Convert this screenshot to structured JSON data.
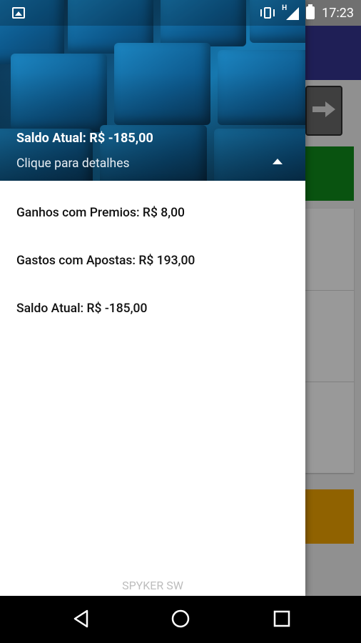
{
  "status_bar": {
    "time": "17:23",
    "icons": [
      "image-icon",
      "vibrate-icon",
      "signal-h-icon",
      "battery-icon"
    ],
    "signal_label": "H"
  },
  "drawer": {
    "header": {
      "title": "Saldo Atual: R$ -185,00",
      "subtitle": "Clique para detalhes",
      "toggle_icon": "caret-up-icon"
    },
    "items": [
      {
        "label": "Ganhos com Premios: R$ 8,00"
      },
      {
        "label": "Gastos com Apostas: R$ 193,00"
      },
      {
        "label": "Saldo Atual: R$ -185,00"
      }
    ],
    "footer": "SPYKER SW"
  },
  "background_app": {
    "colors": {
      "appbar": "#35358f",
      "green": "#0f8a1b",
      "orange": "#f0a400"
    },
    "forward_icon": "arrow-right-icon"
  },
  "nav_bar": {
    "buttons": [
      "back-icon",
      "home-icon",
      "recents-icon"
    ]
  }
}
